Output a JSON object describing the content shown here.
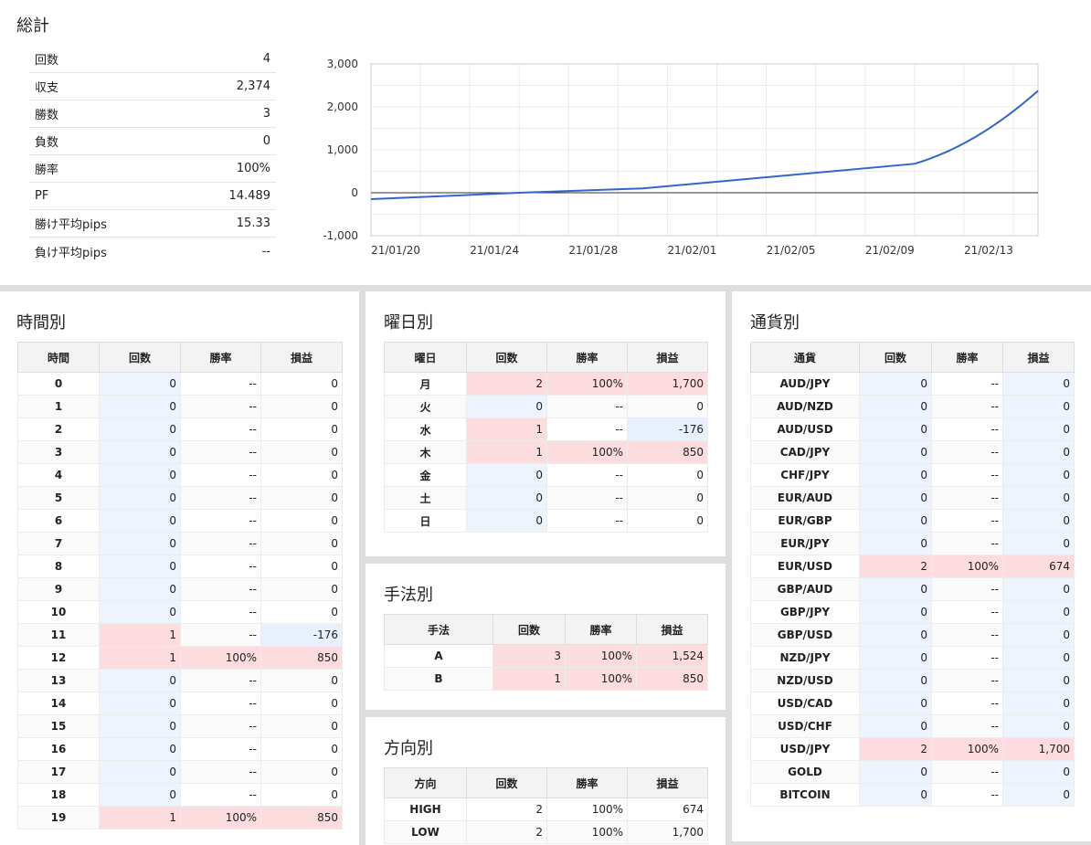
{
  "summary": {
    "title": "総計",
    "stats": [
      {
        "label": "回数",
        "value": "4"
      },
      {
        "label": "収支",
        "value": "2,374"
      },
      {
        "label": "勝数",
        "value": "3"
      },
      {
        "label": "負数",
        "value": "0"
      },
      {
        "label": "勝率",
        "value": "100%"
      },
      {
        "label": "PF",
        "value": "14.489"
      },
      {
        "label": "勝け平均pips",
        "value": "15.33"
      },
      {
        "label": "負け平均pips",
        "value": "--"
      }
    ]
  },
  "chart_data": {
    "type": "line",
    "x": [
      "21/01/19",
      "21/01/25",
      "21/01/30",
      "21/02/10",
      "21/02/15"
    ],
    "series": [
      {
        "values": [
          -150,
          0,
          100,
          674,
          2374
        ]
      }
    ],
    "x_ticks": [
      "21/01/20",
      "21/01/24",
      "21/01/28",
      "21/02/01",
      "21/02/05",
      "21/02/09",
      "21/02/13"
    ],
    "y_ticks": [
      "3,000",
      "2,000",
      "1,000",
      "0",
      "-1,000"
    ],
    "ylim": [
      -1000,
      3000
    ],
    "grid": true,
    "color": "#3366cc"
  },
  "hourly": {
    "title": "時間別",
    "headers": [
      "時間",
      "回数",
      "勝率",
      "損益"
    ],
    "rows": [
      [
        "0",
        "0",
        "--",
        "0"
      ],
      [
        "1",
        "0",
        "--",
        "0"
      ],
      [
        "2",
        "0",
        "--",
        "0"
      ],
      [
        "3",
        "0",
        "--",
        "0"
      ],
      [
        "4",
        "0",
        "--",
        "0"
      ],
      [
        "5",
        "0",
        "--",
        "0"
      ],
      [
        "6",
        "0",
        "--",
        "0"
      ],
      [
        "7",
        "0",
        "--",
        "0"
      ],
      [
        "8",
        "0",
        "--",
        "0"
      ],
      [
        "9",
        "0",
        "--",
        "0"
      ],
      [
        "10",
        "0",
        "--",
        "0"
      ],
      [
        "11",
        "1",
        "--",
        "-176"
      ],
      [
        "12",
        "1",
        "100%",
        "850"
      ],
      [
        "13",
        "0",
        "--",
        "0"
      ],
      [
        "14",
        "0",
        "--",
        "0"
      ],
      [
        "15",
        "0",
        "--",
        "0"
      ],
      [
        "16",
        "0",
        "--",
        "0"
      ],
      [
        "17",
        "0",
        "--",
        "0"
      ],
      [
        "18",
        "0",
        "--",
        "0"
      ],
      [
        "19",
        "1",
        "100%",
        "850"
      ]
    ]
  },
  "weekday": {
    "title": "曜日別",
    "headers": [
      "曜日",
      "回数",
      "勝率",
      "損益"
    ],
    "rows": [
      [
        "月",
        "2",
        "100%",
        "1,700"
      ],
      [
        "火",
        "0",
        "--",
        "0"
      ],
      [
        "水",
        "1",
        "--",
        "-176"
      ],
      [
        "木",
        "1",
        "100%",
        "850"
      ],
      [
        "金",
        "0",
        "--",
        "0"
      ],
      [
        "土",
        "0",
        "--",
        "0"
      ],
      [
        "日",
        "0",
        "--",
        "0"
      ]
    ]
  },
  "method": {
    "title": "手法別",
    "headers": [
      "手法",
      "回数",
      "勝率",
      "損益"
    ],
    "rows": [
      [
        "A",
        "3",
        "100%",
        "1,524"
      ],
      [
        "B",
        "1",
        "100%",
        "850"
      ]
    ]
  },
  "direction": {
    "title": "方向別",
    "headers": [
      "方向",
      "回数",
      "勝率",
      "損益"
    ],
    "rows": [
      [
        "HIGH",
        "2",
        "100%",
        "674"
      ],
      [
        "LOW",
        "2",
        "100%",
        "1,700"
      ]
    ]
  },
  "currency": {
    "title": "通貨別",
    "headers": [
      "通貨",
      "回数",
      "勝率",
      "損益"
    ],
    "rows": [
      [
        "AUD/JPY",
        "0",
        "--",
        "0"
      ],
      [
        "AUD/NZD",
        "0",
        "--",
        "0"
      ],
      [
        "AUD/USD",
        "0",
        "--",
        "0"
      ],
      [
        "CAD/JPY",
        "0",
        "--",
        "0"
      ],
      [
        "CHF/JPY",
        "0",
        "--",
        "0"
      ],
      [
        "EUR/AUD",
        "0",
        "--",
        "0"
      ],
      [
        "EUR/GBP",
        "0",
        "--",
        "0"
      ],
      [
        "EUR/JPY",
        "0",
        "--",
        "0"
      ],
      [
        "EUR/USD",
        "2",
        "100%",
        "674"
      ],
      [
        "GBP/AUD",
        "0",
        "--",
        "0"
      ],
      [
        "GBP/JPY",
        "0",
        "--",
        "0"
      ],
      [
        "GBP/USD",
        "0",
        "--",
        "0"
      ],
      [
        "NZD/JPY",
        "0",
        "--",
        "0"
      ],
      [
        "NZD/USD",
        "0",
        "--",
        "0"
      ],
      [
        "USD/CAD",
        "0",
        "--",
        "0"
      ],
      [
        "USD/CHF",
        "0",
        "--",
        "0"
      ],
      [
        "USD/JPY",
        "2",
        "100%",
        "1,700"
      ],
      [
        "GOLD",
        "0",
        "--",
        "0"
      ],
      [
        "BITCOIN",
        "0",
        "--",
        "0"
      ]
    ]
  },
  "colors": {
    "positive_bg": "#fddcdf",
    "negative_bg": "#e8f0fd",
    "zero_bg": "#eef4fd",
    "line": "#3366cc"
  }
}
